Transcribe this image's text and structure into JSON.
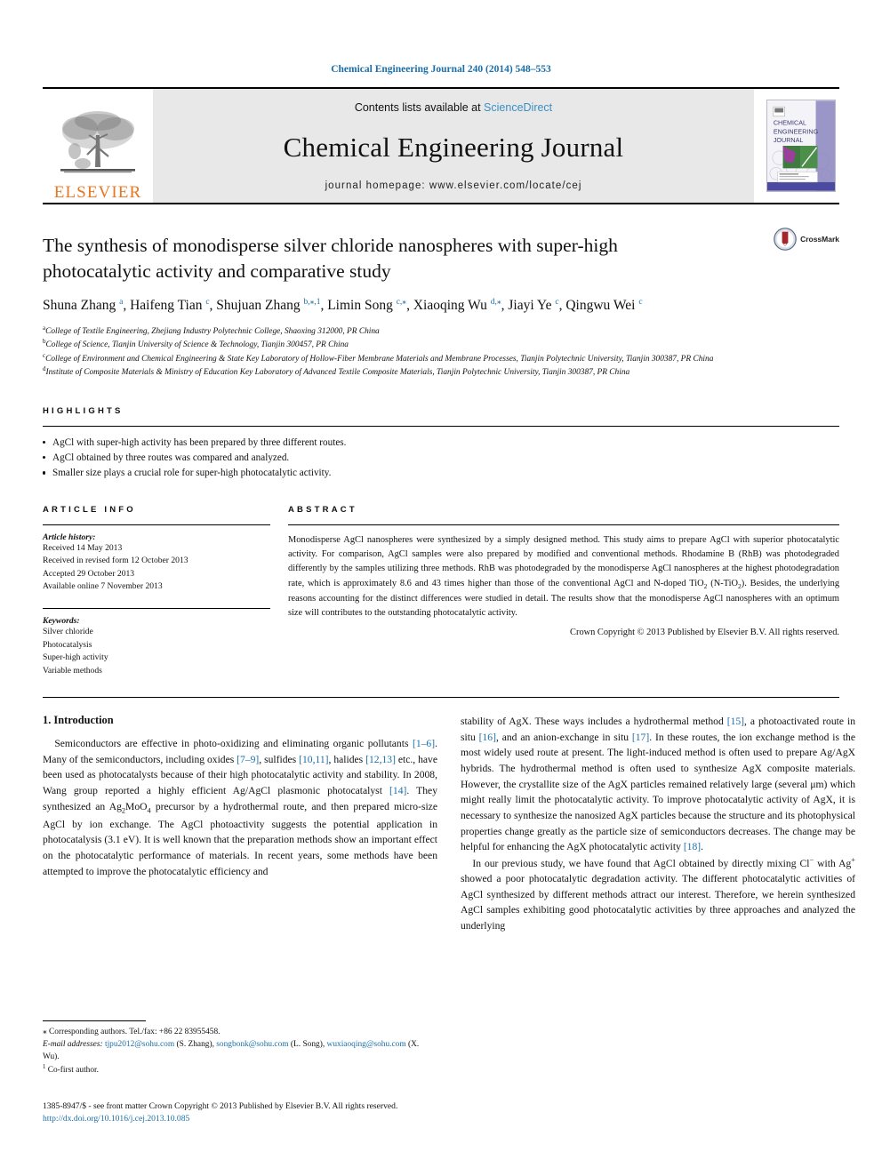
{
  "running_head": "Chemical Engineering Journal 240 (2014) 548–553",
  "masthead": {
    "publisher_name": "ELSEVIER",
    "contents_prefix": "Contents lists available at ",
    "contents_link": "ScienceDirect",
    "journal_title": "Chemical Engineering Journal",
    "homepage": "journal homepage: www.elsevier.com/locate/cej",
    "cover_title_lines": [
      "CHEMICAL",
      "ENGINEERING",
      "JOURNAL"
    ]
  },
  "article": {
    "title": "The synthesis of monodisperse silver chloride nanospheres with super-high photocatalytic activity and comparative study",
    "crossmark_label": "CrossMark",
    "authors_html": "Shuna Zhang <sup>a</sup>, Haifeng Tian <sup>c</sup>, Shujuan Zhang <sup>b,&#8270;,1</sup>, Limin Song <sup>c,&#8270;</sup>, Xiaoqing Wu <sup>d,&#8270;</sup>, Jiayi Ye <sup>c</sup>, Qingwu Wei <sup>c</sup>",
    "affiliations": [
      {
        "mark": "a",
        "text": "College of Textile Engineering, Zhejiang Industry Polytechnic College, Shaoxing 312000, PR China"
      },
      {
        "mark": "b",
        "text": "College of Science, Tianjin University of Science & Technology, Tianjin 300457, PR China"
      },
      {
        "mark": "c",
        "text": "College of Environment and Chemical Engineering & State Key Laboratory of Hollow-Fiber Membrane Materials and Membrane Processes, Tianjin Polytechnic University, Tianjin 300387, PR China"
      },
      {
        "mark": "d",
        "text": "Institute of Composite Materials & Ministry of Education Key Laboratory of Advanced Textile Composite Materials, Tianjin Polytechnic University, Tianjin 300387, PR China"
      }
    ]
  },
  "highlights": {
    "heading": "HIGHLIGHTS",
    "items": [
      "AgCl with super-high activity has been prepared by three different routes.",
      "AgCl obtained by three routes was compared and analyzed.",
      "Smaller size plays a crucial role for super-high photocatalytic activity."
    ]
  },
  "article_info": {
    "heading": "ARTICLE INFO",
    "history_label": "Article history:",
    "history": [
      "Received 14 May 2013",
      "Received in revised form 12 October 2013",
      "Accepted 29 October 2013",
      "Available online 7 November 2013"
    ],
    "keywords_label": "Keywords:",
    "keywords": [
      "Silver chloride",
      "Photocatalysis",
      "Super-high activity",
      "Variable methods"
    ]
  },
  "abstract": {
    "heading": "ABSTRACT",
    "text_html": "Monodisperse AgCl nanospheres were synthesized by a simply designed method. This study aims to prepare AgCl with superior photocatalytic activity. For comparison, AgCl samples were also prepared by modified and conventional methods. Rhodamine B (RhB) was photodegraded differently by the samples utilizing three methods. RhB was photodegraded by the monodisperse AgCl nanospheres at the highest photodegradation rate, which is approximately 8.6 and 43 times higher than those of the conventional AgCl and N-doped TiO<sub>2</sub> (N-TiO<sub>2</sub>). Besides, the underlying reasons accounting for the distinct differences were studied in detail. The results show that the monodisperse AgCl nanospheres with an optimum size will contributes to the outstanding photocatalytic activity.",
    "copyright": "Crown Copyright © 2013 Published by Elsevier B.V. All rights reserved."
  },
  "body": {
    "section_title": "1. Introduction",
    "left_paragraphs_html": [
      "Semiconductors are effective in photo-oxidizing and eliminating organic pollutants <span class=\"ref\">[1–6]</span>. Many of the semiconductors, including oxides <span class=\"ref\">[7–9]</span>, sulfides <span class=\"ref\">[10,11]</span>, halides <span class=\"ref\">[12,13]</span> etc., have been used as photocatalysts because of their high photocatalytic activity and stability. In 2008, Wang group reported a highly efficient Ag/AgCl plasmonic photocatalyst <span class=\"ref\">[14]</span>. They synthesized an Ag<sub>2</sub>MoO<sub>4</sub> precursor by a hydrothermal route, and then prepared micro-size AgCl by ion exchange. The AgCl photoactivity suggests the potential application in photocatalysis (3.1 eV). It is well known that the preparation methods show an important effect on the photocatalytic performance of materials. In recent years, some methods have been attempted to improve the photocatalytic efficiency and"
    ],
    "right_paragraphs_html": [
      "stability of AgX. These ways includes a hydrothermal method <span class=\"ref\">[15]</span>, a photoactivated route in situ <span class=\"ref\">[16]</span>, and an anion-exchange in situ <span class=\"ref\">[17]</span>. In these routes, the ion exchange method is the most widely used route at present. The light-induced method is often used to prepare Ag/AgX hybrids. The hydrothermal method is often used to synthesize AgX composite materials. However, the crystallite size of the AgX particles remained relatively large (several μm) which might really limit the photocatalytic activity. To improve photocatalytic activity of AgX, it is necessary to synthesize the nanosized AgX particles because the structure and its photophysical properties change greatly as the particle size of semiconductors decreases. The change may be helpful for enhancing the AgX photocatalytic activity <span class=\"ref\">[18]</span>.",
      "In our previous study, we have found that AgCl obtained by directly mixing Cl<sup class=\"n\">−</sup> with Ag<sup class=\"n\">+</sup> showed a poor photocatalytic degradation activity. The different photocatalytic activities of AgCl synthesized by different methods attract our interest. Therefore, we herein synthesized AgCl samples exhibiting good photocatalytic activities by three approaches and analyzed the underlying"
    ]
  },
  "footnotes": {
    "corresponding_html": "&#8270; Corresponding authors. Tel./fax: +86 22 83955458.",
    "email_label": "E-mail addresses:",
    "emails_html": "<a class=\"link\">tjpu2012@sohu.com</a> (S. Zhang), <a class=\"link\">songbonk@sohu.com</a> (L. Song), <a class=\"link\">wuxiaoqing@sohu.com</a> (X. Wu).",
    "cofirst_html": "<sup class=\"n\">1</sup> Co-first author."
  },
  "bottom": {
    "issn_line": "1385-8947/$ - see front matter Crown Copyright © 2013 Published by Elsevier B.V. All rights reserved.",
    "doi": "http://dx.doi.org/10.1016/j.cej.2013.10.085"
  },
  "colors": {
    "link": "#1a6fa8",
    "elsevier_orange": "#E87722",
    "masthead_bg": "#e8e8e8"
  }
}
